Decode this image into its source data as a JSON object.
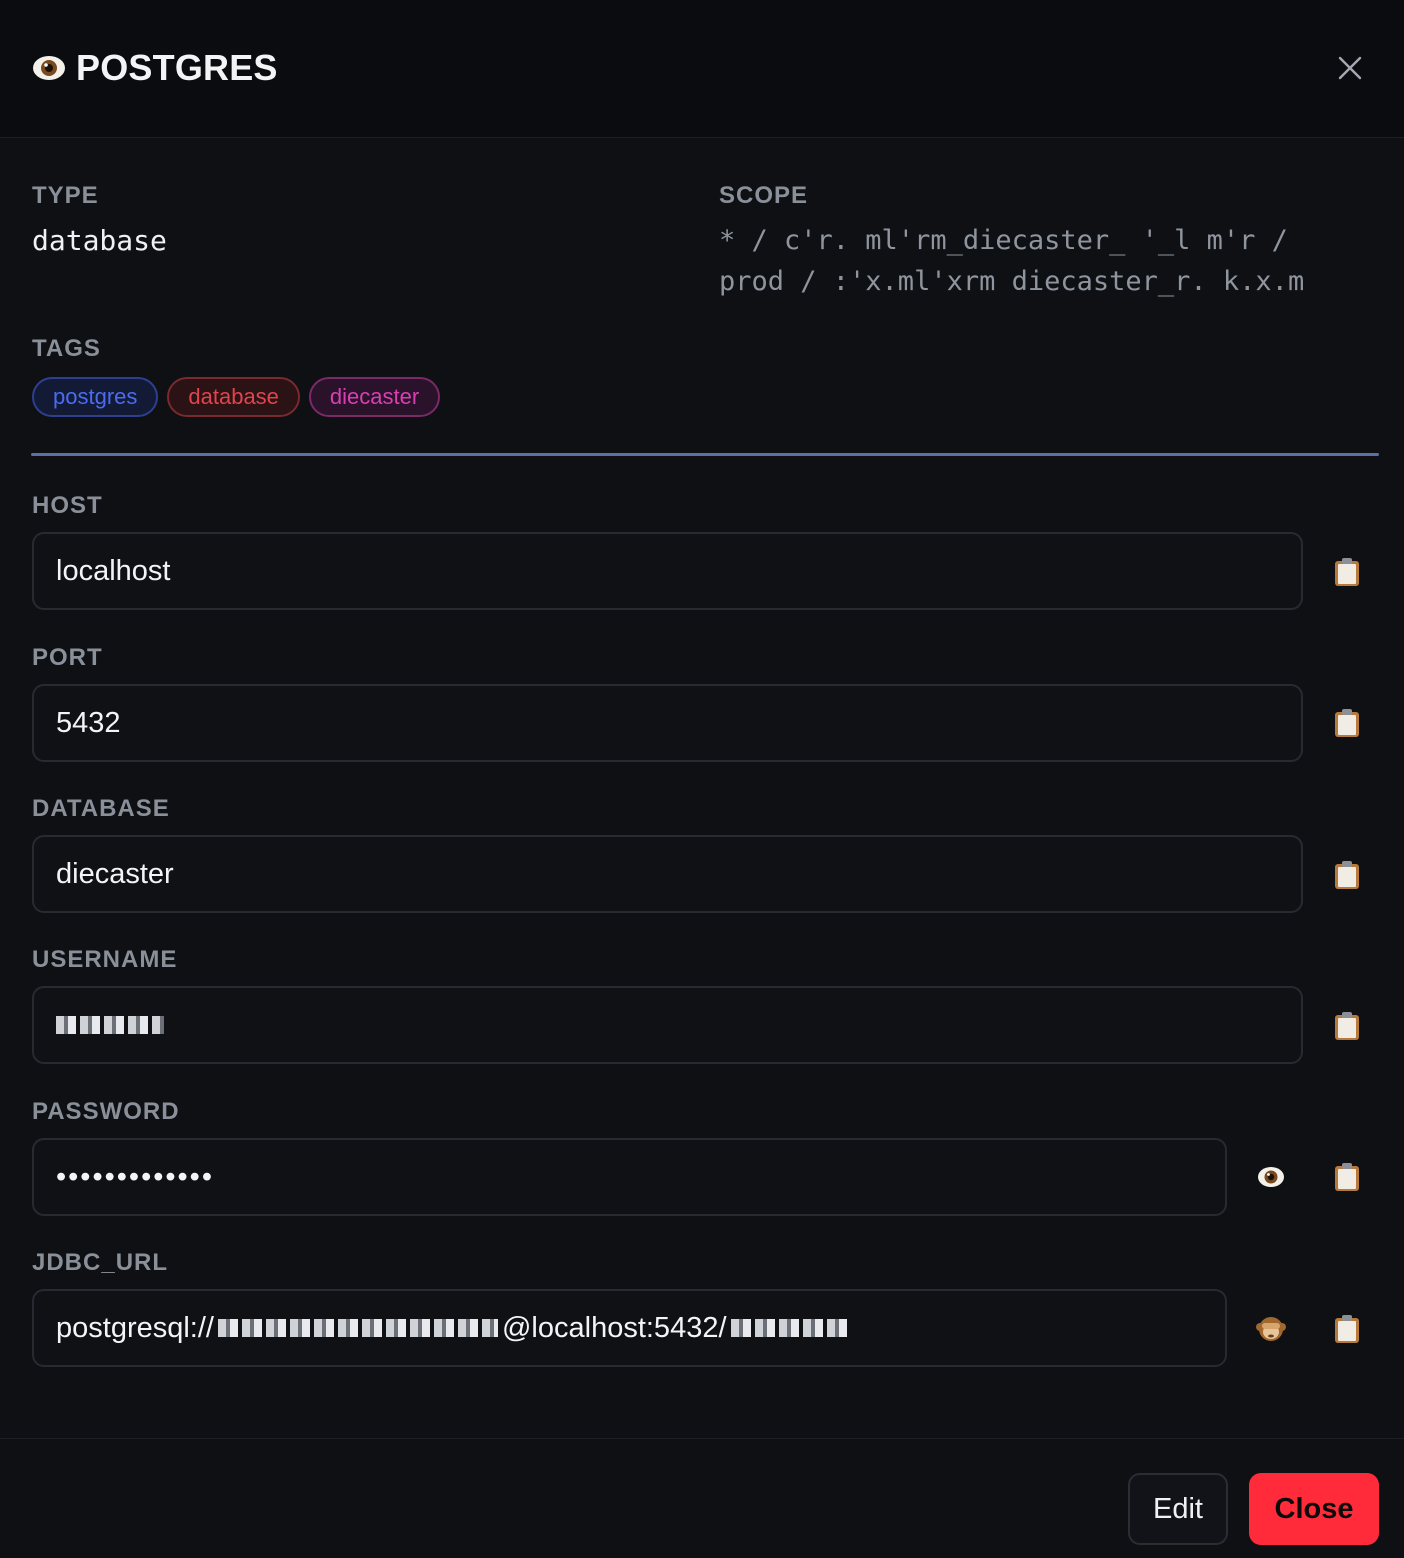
{
  "header": {
    "icon": "eye-icon",
    "title": "POSTGRES",
    "close_icon": "close-icon"
  },
  "meta": {
    "type_label": "TYPE",
    "type_value": "database",
    "scope_label": "SCOPE",
    "scope_line1": "* / c'r. ml'rm_diecaster_ '_l m'r /",
    "scope_line2": "prod / :'x.ml'xrm diecaster_r. k.x.m"
  },
  "tags": {
    "label": "TAGS",
    "items": [
      {
        "label": "postgres",
        "color": "#4b6bf0"
      },
      {
        "label": "database",
        "color": "#e0444d"
      },
      {
        "label": "diecaster",
        "color": "#d93fb3"
      }
    ]
  },
  "fields": {
    "host": {
      "label": "HOST",
      "value": "localhost"
    },
    "port": {
      "label": "PORT",
      "value": "5432"
    },
    "database": {
      "label": "DATABASE",
      "value": "diecaster"
    },
    "username": {
      "label": "USERNAME",
      "value": ""
    },
    "password": {
      "label": "PASSWORD",
      "value": "•••••••••••••"
    },
    "jdbc_url": {
      "label": "JDBC_URL",
      "value_prefix": "postgresql://",
      "value_suffix": "@localhost:5432/"
    }
  },
  "footer": {
    "edit_label": "Edit",
    "close_label": "Close"
  },
  "colors": {
    "background": "#0e1014",
    "accent_close": "#ff2b3b",
    "divider": "#5b6fa8"
  }
}
